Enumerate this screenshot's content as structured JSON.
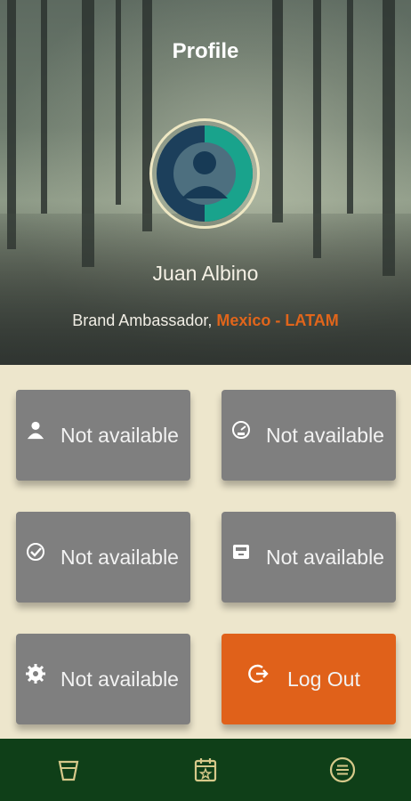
{
  "header": {
    "title": "Profile"
  },
  "user": {
    "name": "Juan Albino",
    "role": "Brand Ambassador,",
    "region": "Mexico - LATAM"
  },
  "tiles": [
    {
      "label": "Not available",
      "icon": "person-icon"
    },
    {
      "label": "Not available",
      "icon": "speedometer-icon"
    },
    {
      "label": "Not available",
      "icon": "check-circle-icon"
    },
    {
      "label": "Not available",
      "icon": "inbox-icon"
    },
    {
      "label": "Not available",
      "icon": "gear-icon"
    },
    {
      "label": "Log Out",
      "icon": "logout-icon"
    }
  ],
  "bottom_nav": [
    {
      "icon": "cup-icon"
    },
    {
      "icon": "calendar-star-icon"
    },
    {
      "icon": "menu-circle-icon"
    }
  ],
  "colors": {
    "accent": "#e0611a",
    "tile_bg": "#7f7f7f",
    "page_bg": "#ede6cc",
    "nav_bg": "#0f3f18",
    "avatar_teal": "#19a38c",
    "avatar_navy": "#1c3f5b"
  }
}
